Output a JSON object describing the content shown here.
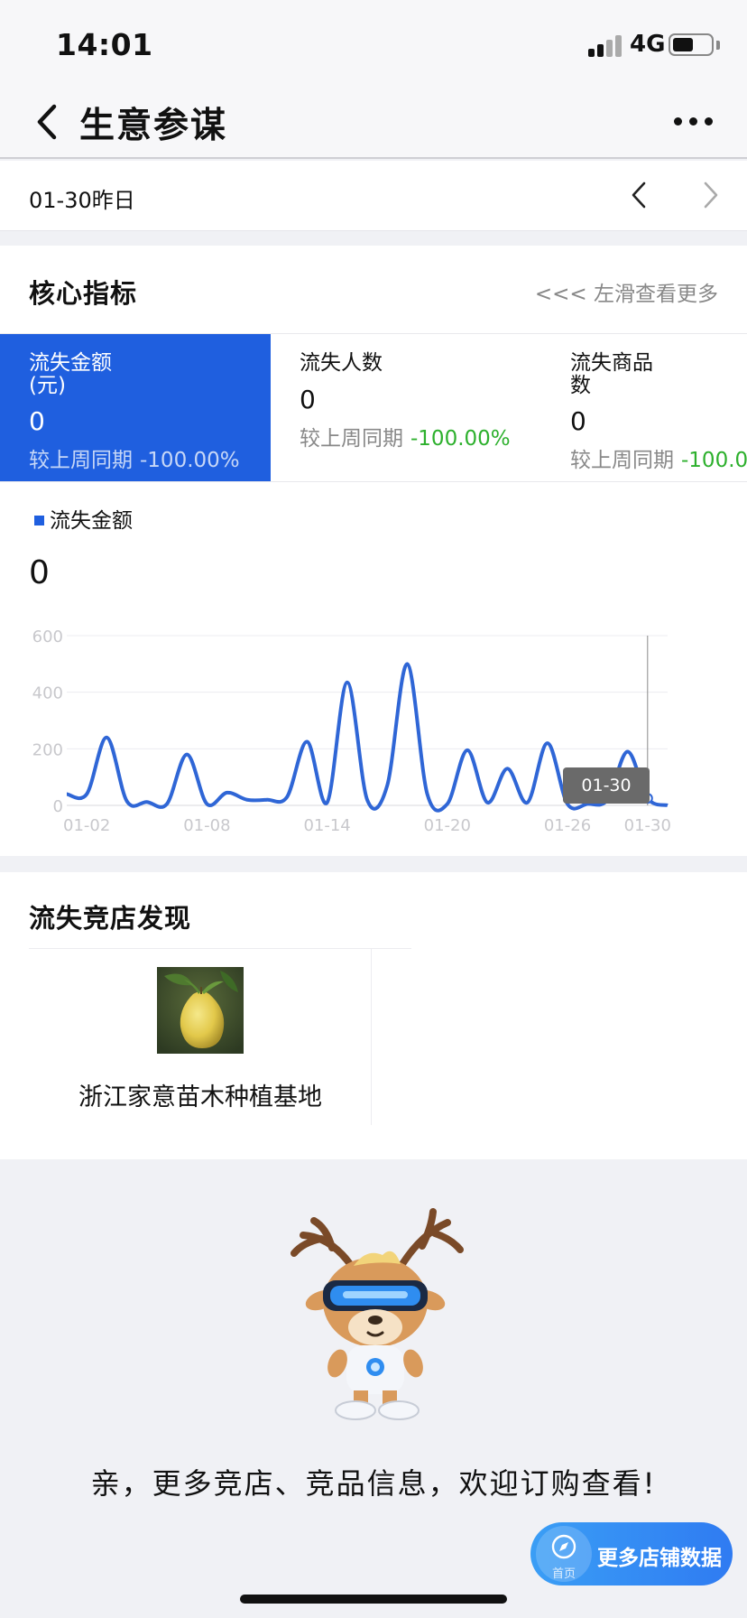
{
  "status": {
    "time": "14:01",
    "network": "4G",
    "battery_percent": 55
  },
  "nav": {
    "title": "生意参谋",
    "back_icon": "chevron-left-icon",
    "more_icon": "ellipsis-icon"
  },
  "date_bar": {
    "label": "01-30昨日",
    "prev_icon": "chevron-left-icon",
    "next_icon": "chevron-right-icon"
  },
  "core": {
    "title": "核心指标",
    "swipe_hint": "<<< 左滑查看更多",
    "metrics": [
      {
        "title": "流失金额\n(元)",
        "value": "0",
        "compare_label": "较上周同期",
        "delta": "-100.00%",
        "active": true
      },
      {
        "title": "流失人数",
        "value": "0",
        "compare_label": "较上周同期",
        "delta": "-100.00%",
        "active": false
      },
      {
        "title": "流失商品数",
        "value": "0",
        "compare_label": "较上周同期",
        "delta": "-100.00%",
        "active": false
      }
    ],
    "legend": "流失金额",
    "current_value": "0",
    "tooltip": "01-30"
  },
  "chart_data": {
    "type": "line",
    "series": [
      {
        "name": "流失金额",
        "values": [
          40,
          40,
          240,
          15,
          12,
          5,
          180,
          5,
          45,
          20,
          20,
          30,
          225,
          10,
          435,
          20,
          70,
          500,
          40,
          5,
          195,
          10,
          130,
          10,
          220,
          5,
          5,
          20,
          190,
          25,
          0
        ]
      }
    ],
    "x": [
      "01-01",
      "01-02",
      "01-03",
      "01-04",
      "01-05",
      "01-06",
      "01-07",
      "01-08",
      "01-09",
      "01-10",
      "01-11",
      "01-12",
      "01-13",
      "01-14",
      "01-15",
      "01-16",
      "01-17",
      "01-18",
      "01-19",
      "01-20",
      "01-21",
      "01-22",
      "01-23",
      "01-24",
      "01-25",
      "01-26",
      "01-27",
      "01-28",
      "01-29",
      "01-30",
      "01-31"
    ],
    "x_tick_labels": [
      "01-02",
      "01-08",
      "01-14",
      "01-20",
      "01-26",
      "01-30"
    ],
    "y_tick_labels": [
      "0",
      "200",
      "400",
      "600"
    ],
    "ylim": [
      0,
      600
    ],
    "grid": true,
    "color": "#2f66d6"
  },
  "competitors": {
    "title": "流失竞店发现",
    "shops": [
      {
        "name": "浙江家意苗木种植基地",
        "image": "pomelo-fruit-photo"
      }
    ]
  },
  "promo": {
    "text": "亲，更多竞店、竞品信息，欢迎订购查看!",
    "mascot": "deer-mascot-illustration",
    "button_label": "更多店铺数据",
    "home_label": "首页",
    "home_icon": "compass-icon"
  }
}
